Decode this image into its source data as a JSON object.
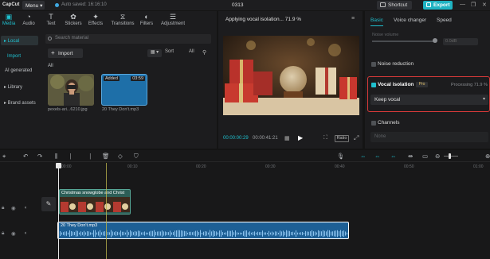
{
  "titlebar": {
    "app_logo": "CapCut",
    "menu_label": "Menu",
    "autosave_text": "Auto saved: 16:16:10",
    "project_title": "0313",
    "shortcut_label": "Shortcut",
    "export_label": "Export",
    "window_controls": [
      "—",
      "❐",
      "✕"
    ]
  },
  "toolbar": {
    "tabs": [
      {
        "label": "Media",
        "icon": "media-icon",
        "glyph": "▣",
        "active": true
      },
      {
        "label": "Audio",
        "icon": "audio-icon",
        "glyph": "◔",
        "active": false
      },
      {
        "label": "Text",
        "icon": "text-icon",
        "glyph": "T",
        "active": false
      },
      {
        "label": "Stickers",
        "icon": "sticker-icon",
        "glyph": "✿",
        "active": false
      },
      {
        "label": "Effects",
        "icon": "effects-icon",
        "glyph": "✦",
        "active": false
      },
      {
        "label": "Transitions",
        "icon": "transitions-icon",
        "glyph": "⧖",
        "active": false
      },
      {
        "label": "Filters",
        "icon": "filters-icon",
        "glyph": "◐",
        "active": false
      },
      {
        "label": "Adjustment",
        "icon": "adjustment-icon",
        "glyph": "☰",
        "active": false
      }
    ]
  },
  "sidebar": {
    "items": [
      {
        "label": "▸ Local",
        "active": true
      },
      {
        "label": "Import",
        "sub": true,
        "selected": true
      },
      {
        "label": "AI generated",
        "sub": true
      },
      {
        "label": "▸ Library"
      },
      {
        "label": "▸ Brand assets"
      }
    ]
  },
  "media": {
    "search_placeholder": "Search material",
    "import_label": "Import",
    "view_label": "▦ ▾",
    "sort_label": "Sort",
    "all_filter_label": "All",
    "all_label": "All",
    "items": [
      {
        "name": "pexels-ari...6210.jpg"
      },
      {
        "name": "20 They Don't.mp3",
        "badge": "Added",
        "duration": "03:59"
      }
    ]
  },
  "player": {
    "status": "Applying vocal isolation...  71.9 %",
    "time_current": "00:00:00:29",
    "time_total": "00:00:41:21",
    "ratio_label": "Ratio"
  },
  "properties": {
    "tabs": [
      {
        "label": "Basic",
        "active": true
      },
      {
        "label": "Voice changer",
        "active": false
      },
      {
        "label": "Speed",
        "active": false
      }
    ],
    "volume_label": "Noise volume",
    "volume_value": "0.0dB",
    "noise_reduction_label": "Noise reduction",
    "vocal_isolation_label": "Vocal isolation",
    "pro_badge": "Pro",
    "vocal_status": "Processing  71.9 %",
    "vocal_option": "Keep vocal",
    "channels_label": "Channels",
    "channels_value": "None"
  },
  "timeline": {
    "ruler_ticks": [
      "00:00",
      "00:10",
      "00:20",
      "00:30",
      "00:40",
      "00:50",
      "01:00"
    ],
    "video_clip_name": "Christmas snowglobe and Christ",
    "audio_clip_name": "20 They Don't.mp3",
    "cover_label": "✎"
  },
  "colors": {
    "accent": "#1fc0cf",
    "highlight_border": "#d93a3a",
    "audio_clip": "#1d5f95",
    "video_clip": "#2d5e57"
  }
}
